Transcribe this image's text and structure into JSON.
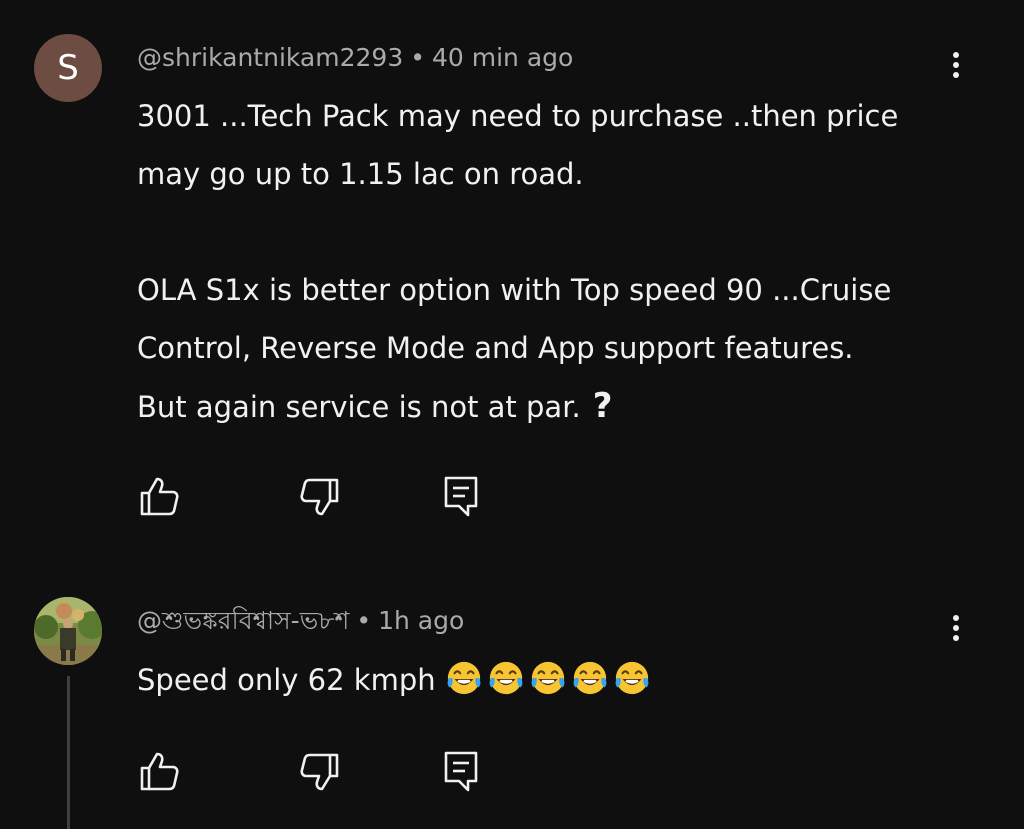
{
  "comments": [
    {
      "avatar_letter": "S",
      "avatar_color": "#6d4c41",
      "author": "@shrikantnikam2293",
      "separator": "•",
      "time": "40 min ago",
      "lines": [
        "3001 ...Tech Pack may need to purchase ..then price",
        "may go up to 1.15 lac on road.",
        "",
        "OLA S1x is better option with Top speed 90 ...Cruise",
        "Control, Reverse Mode and App support features.",
        "But again service is not at par."
      ],
      "trailing_emoji": "?",
      "icons": [
        "like-icon",
        "dislike-icon",
        "reply-icon",
        "more-options-icon"
      ]
    },
    {
      "author": "@শুভঙ্করবিশ্বাস-ভ৮শ",
      "separator": "•",
      "time": "1h ago",
      "text": "Speed only 62 kmph",
      "emoji_count": 5,
      "emoji_name": "face-with-tears-of-joy",
      "icons": [
        "like-icon",
        "dislike-icon",
        "reply-icon",
        "more-options-icon"
      ]
    }
  ],
  "colors": {
    "background": "#0f0f0f",
    "text": "#f1f1f1",
    "meta": "#aaaaaa",
    "thread_line": "#3f3f3f"
  }
}
